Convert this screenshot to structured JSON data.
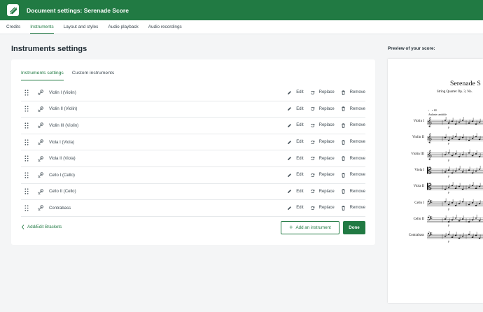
{
  "header": {
    "title": "Document settings: Serenade Score",
    "brand_color": "#217a43"
  },
  "tabs": [
    {
      "label": "Credits",
      "active": false
    },
    {
      "label": "Instruments",
      "active": true
    },
    {
      "label": "Layout and styles",
      "active": false
    },
    {
      "label": "Audio playback",
      "active": false
    },
    {
      "label": "Audio recordings",
      "active": false
    }
  ],
  "main": {
    "title": "Instruments settings",
    "subtabs": [
      {
        "label": "Instruments settings",
        "active": true
      },
      {
        "label": "Custom instruments",
        "active": false
      }
    ],
    "instruments": [
      {
        "name": "Violin I  (Violin)"
      },
      {
        "name": "Violin II  (Violin)"
      },
      {
        "name": "Violin III  (Violin)"
      },
      {
        "name": "Viola I  (Viola)"
      },
      {
        "name": "Viola II  (Viola)"
      },
      {
        "name": "Cello I  (Cello)"
      },
      {
        "name": "Cello II  (Cello)"
      },
      {
        "name": "Contrabass"
      }
    ],
    "actions": {
      "edit": "Edit",
      "replace": "Replace",
      "remove": "Remove"
    },
    "brackets_link": "Add/Edit Brackets",
    "add_button": "Add an instrument",
    "done_button": "Done"
  },
  "preview": {
    "label": "Preview of your score:",
    "score_title": "Serenade S",
    "score_subtitle": "String Quartet Op. 3, No.",
    "tempo": "♩ = 60",
    "tempo_text": "Andante cantabile",
    "staves": [
      "Violin I",
      "Violin II",
      "Violin III",
      "Viola I",
      "Viola II",
      "Cello I",
      "Cello II",
      "Contrabass"
    ],
    "dynamic": "p"
  }
}
